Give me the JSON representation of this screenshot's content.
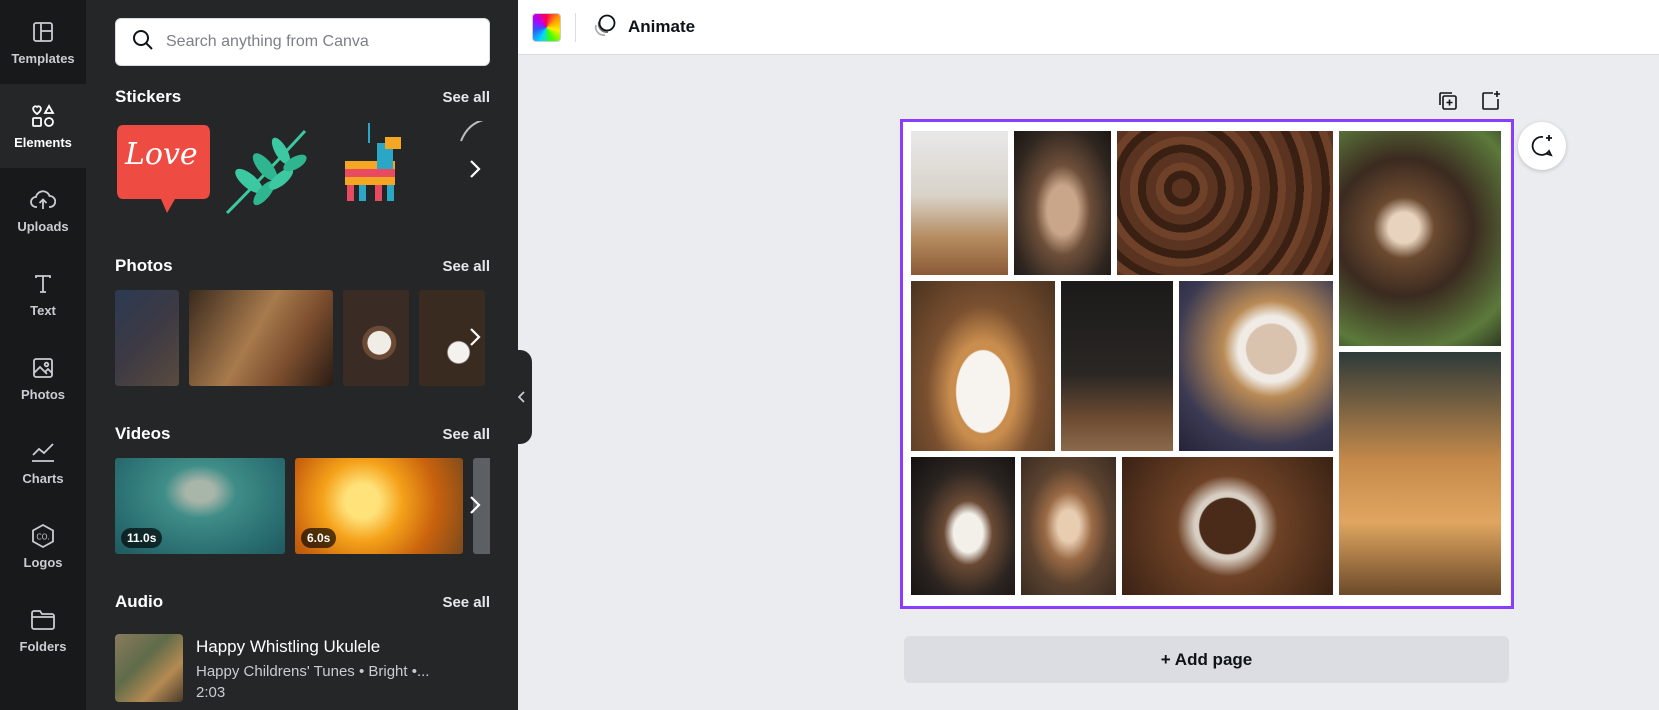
{
  "rail": {
    "items": [
      {
        "label": "Templates",
        "icon": "templates-icon"
      },
      {
        "label": "Elements",
        "icon": "elements-icon",
        "active": true
      },
      {
        "label": "Uploads",
        "icon": "upload-cloud-icon"
      },
      {
        "label": "Text",
        "icon": "text-icon"
      },
      {
        "label": "Photos",
        "icon": "photos-icon"
      },
      {
        "label": "Charts",
        "icon": "charts-icon"
      },
      {
        "label": "Logos",
        "icon": "logos-icon"
      },
      {
        "label": "Folders",
        "icon": "folder-icon"
      }
    ]
  },
  "search": {
    "placeholder": "Search anything from Canva"
  },
  "sections": {
    "stickers": {
      "title": "Stickers",
      "see_all": "See all"
    },
    "photos": {
      "title": "Photos",
      "see_all": "See all"
    },
    "videos": {
      "title": "Videos",
      "see_all": "See all",
      "durations": [
        "11.0s",
        "6.0s"
      ]
    },
    "audio": {
      "title": "Audio",
      "see_all": "See all"
    }
  },
  "stickers": {
    "love_text": "Love"
  },
  "audio": {
    "title": "Happy Whistling Ukulele",
    "subtitle": "Happy Childrens' Tunes • Bright •...",
    "duration": "2:03"
  },
  "toolbar": {
    "animate_label": "Animate"
  },
  "canvas": {
    "add_page_label": "+ Add page"
  },
  "colors": {
    "accent": "#8b3dff",
    "panel": "#252627",
    "rail": "#18191b",
    "canvas_bg": "#ebecf0"
  }
}
